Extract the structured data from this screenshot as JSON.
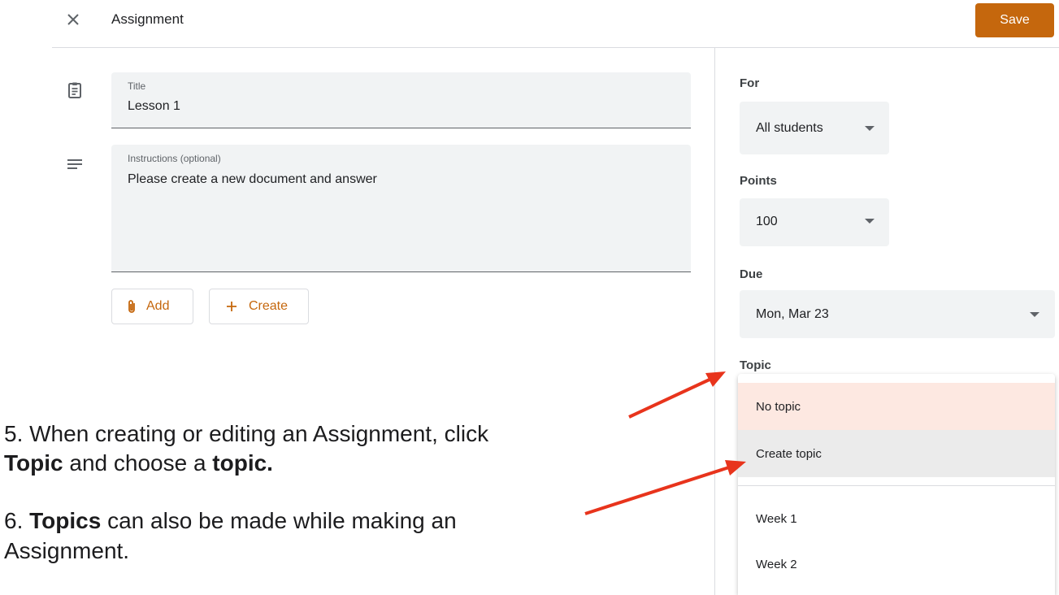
{
  "header": {
    "close_icon": "close-icon",
    "title": "Assignment",
    "save_label": "Save",
    "accent_color": "#c5670d"
  },
  "form": {
    "title": {
      "icon": "assignment-clipboard-icon",
      "label": "Title",
      "value": "Lesson 1"
    },
    "instructions": {
      "icon": "notes-lines-icon",
      "label": "Instructions (optional)",
      "value": "Please create a new document and answer"
    },
    "add_label": "Add",
    "add_icon": "paperclip-icon",
    "create_label": "Create",
    "create_icon": "plus-icon"
  },
  "sidebar": {
    "for_label": "For",
    "for_value": "All students",
    "points_label": "Points",
    "points_value": "100",
    "due_label": "Due",
    "due_value": "Mon, Mar 23",
    "topic_label": "Topic",
    "topic_menu": {
      "items": [
        {
          "label": "No topic",
          "state": "selected"
        },
        {
          "label": "Create topic",
          "state": "hover"
        },
        {
          "label": "Week 1"
        },
        {
          "label": "Week 2"
        }
      ]
    }
  },
  "annotations": {
    "step5_prefix": "5.   When creating or editing an Assignment, click",
    "step5_topic": "Topic",
    "step5_mid": " and choose a ",
    "step5_topic2": "topic.",
    "step6_prefix": "6. ",
    "step6_topics": "Topics",
    "step6_rest": " can also be made while making an",
    "step6_line2": "Assignment.",
    "arrow_color": "#e8341c"
  }
}
